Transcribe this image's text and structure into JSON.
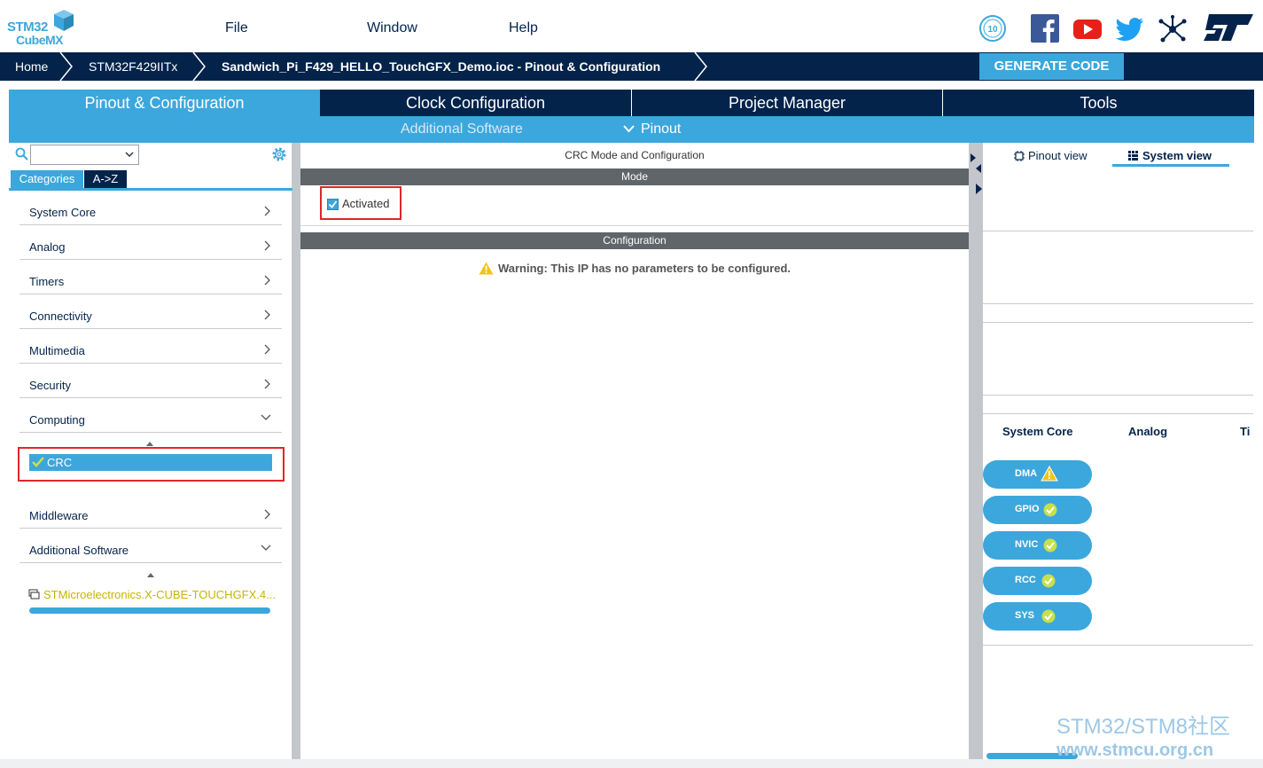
{
  "app": {
    "logo_line1": "STM32",
    "logo_line2": "CubeMX"
  },
  "menu": {
    "file": "File",
    "window": "Window",
    "help": "Help"
  },
  "breadcrumb": {
    "home": "Home",
    "device": "STM32F429IITx",
    "project": "Sandwich_Pi_F429_HELLO_TouchGFX_Demo.ioc - Pinout & Configuration"
  },
  "actions": {
    "generate": "GENERATE CODE"
  },
  "tabs": [
    {
      "label": "Pinout & Configuration"
    },
    {
      "label": "Clock Configuration"
    },
    {
      "label": "Project Manager"
    },
    {
      "label": "Tools"
    }
  ],
  "subtabs": {
    "additional_software": "Additional Software",
    "pinout": "Pinout"
  },
  "left": {
    "search_value": "",
    "cat_tabs": [
      "Categories",
      "A->Z"
    ],
    "categories": [
      {
        "label": "System Core"
      },
      {
        "label": "Analog"
      },
      {
        "label": "Timers"
      },
      {
        "label": "Connectivity"
      },
      {
        "label": "Multimedia"
      },
      {
        "label": "Security"
      },
      {
        "label": "Computing"
      }
    ],
    "selected_item": "CRC",
    "more_categories": [
      {
        "label": "Middleware"
      },
      {
        "label": "Additional Software"
      }
    ],
    "software_pack": "STMicroelectronics.X-CUBE-TOUCHGFX.4..."
  },
  "center": {
    "title": "CRC Mode and Configuration",
    "mode_header": "Mode",
    "activated_label": "Activated",
    "config_header": "Configuration",
    "warning": "Warning: This IP has no parameters to be configured."
  },
  "right": {
    "views": [
      {
        "label": "Pinout view"
      },
      {
        "label": "System view"
      }
    ],
    "columns": [
      "System Core",
      "Analog",
      "Ti"
    ],
    "peripherals": [
      {
        "label": "DMA",
        "status": "warning"
      },
      {
        "label": "GPIO",
        "status": "ok"
      },
      {
        "label": "NVIC",
        "status": "ok"
      },
      {
        "label": "RCC",
        "status": "ok"
      },
      {
        "label": "SYS",
        "status": "ok"
      }
    ]
  },
  "watermark": {
    "line1": "STM32/STM8社区",
    "line2": "www.stmcu.org.cn"
  },
  "colors": {
    "navy": "#03234b",
    "accent": "#3ca7dc",
    "warning": "#f3c316",
    "ok": "#c8e04a",
    "highlight": "#e0262b"
  }
}
